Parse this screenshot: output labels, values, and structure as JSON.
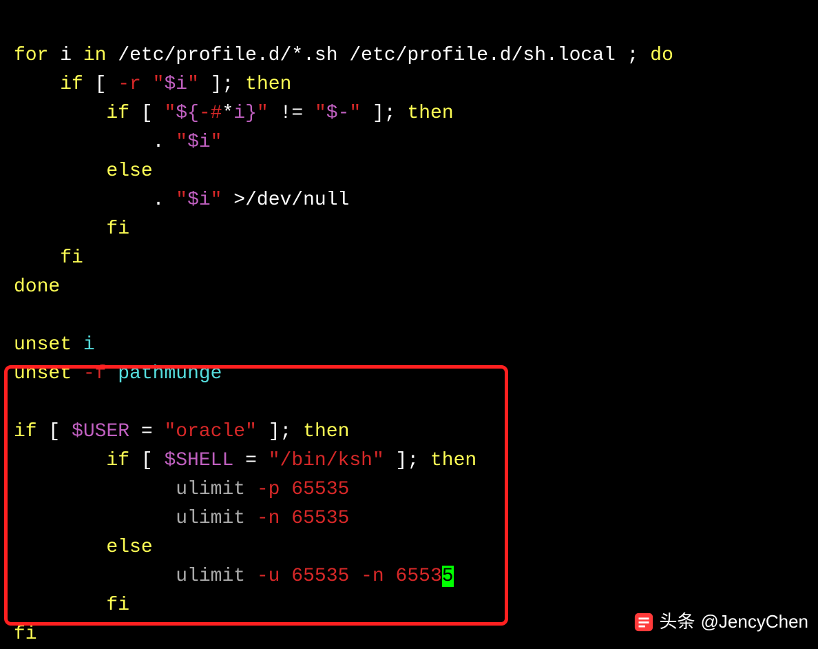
{
  "code": {
    "l1": {
      "for_": "for",
      "i": "i",
      "in_": "in",
      "path1": "/etc/profile.d/*.sh",
      "path2": "/etc/profile.d/sh.local",
      "semi": ";",
      "do_": "do"
    },
    "l2": {
      "if_": "if",
      "lb": "[ ",
      "flag": "-r",
      "sp": " ",
      "q1": "\"",
      "var": "$i",
      "q2": "\"",
      "rb": " ];",
      "then_": "then"
    },
    "l3": {
      "if_": "if",
      "lb": "[ ",
      "q1": "\"",
      "v1": "${",
      "flag": "-#",
      "star": "*",
      "v2": "i}",
      "q2": "\"",
      "neq": "!=",
      "q3": "\"",
      "v3": "$-",
      "q4": "\"",
      "rb": " ];",
      "then_": "then"
    },
    "l4": {
      "dot": ". ",
      "q1": "\"",
      "var": "$i",
      "q2": "\""
    },
    "l5": {
      "else_": "else"
    },
    "l6": {
      "dot": ". ",
      "q1": "\"",
      "var": "$i",
      "q2": "\"",
      "redir": " >",
      "path": "/dev/null"
    },
    "l7": {
      "fi_": "fi"
    },
    "l8": {
      "fi_": "fi"
    },
    "l9": {
      "done_": "done"
    },
    "l11": {
      "unset_": "unset",
      "i": "i"
    },
    "l12": {
      "unset_": "unset",
      "flag": "-f",
      "fn": "pathmunge"
    },
    "l14": {
      "if_": "if",
      "lb": "[ ",
      "var": "$USER",
      "eq": " = ",
      "q1": "\"",
      "val": "oracle",
      "q2": "\"",
      "rb": " ];",
      "then_": "then"
    },
    "l15": {
      "if_": "if",
      "lb": "[ ",
      "var": "$SHELL",
      "eq": " = ",
      "q1": "\"",
      "val": "/bin/ksh",
      "q2": "\"",
      "rb": " ];",
      "then_": "then"
    },
    "l16": {
      "cmd": "ulimit ",
      "flag": "-p",
      "num": "65535"
    },
    "l17": {
      "cmd": "ulimit ",
      "flag": "-n",
      "num": "65535"
    },
    "l18": {
      "else_": "else"
    },
    "l19": {
      "cmd": "ulimit ",
      "f1": "-u",
      "n1": "65535",
      "f2": "-n",
      "n2a": "6553",
      "n2b": "5"
    },
    "l20": {
      "fi_": "fi"
    },
    "l21": {
      "fi_": "fi"
    }
  },
  "watermark": {
    "label": "头条",
    "handle": "@JencyChen"
  }
}
